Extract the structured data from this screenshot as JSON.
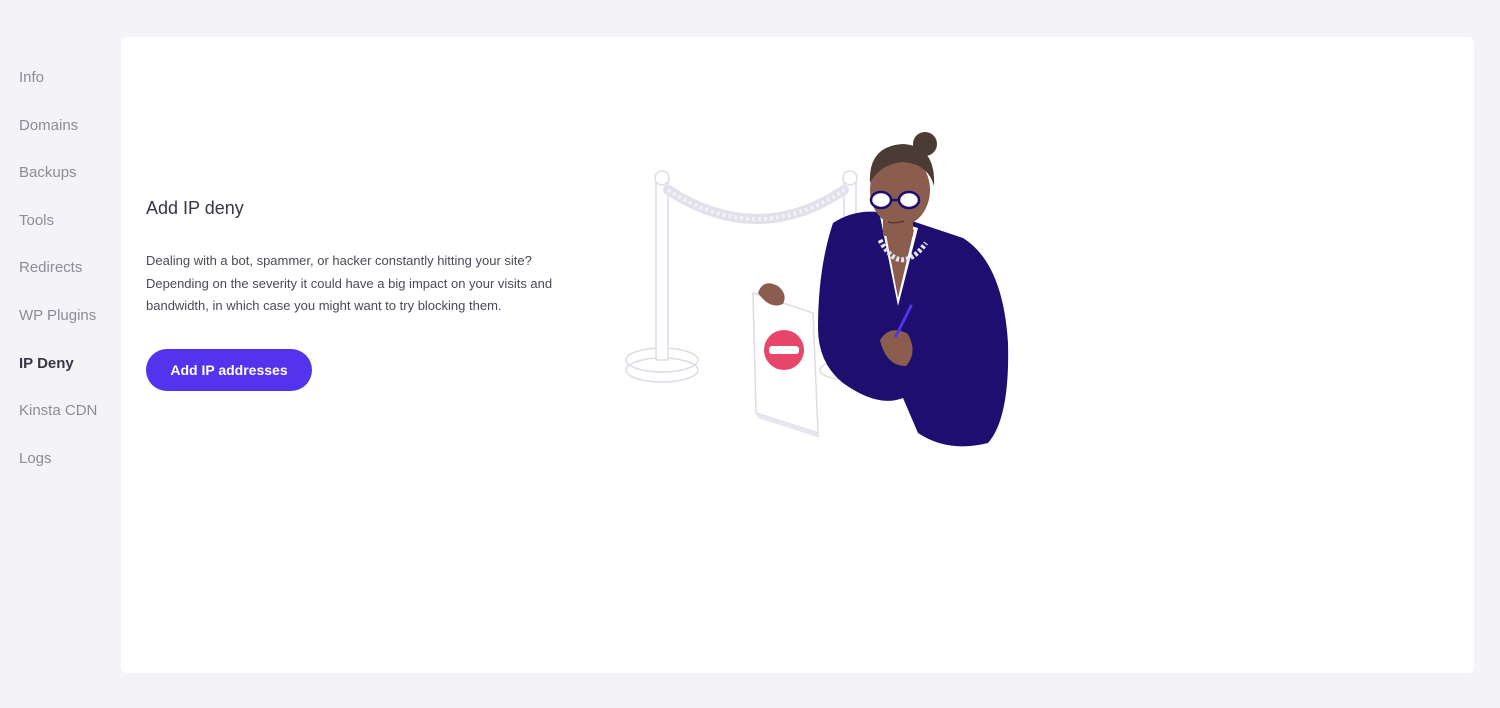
{
  "sidebar": {
    "items": [
      {
        "label": "Info"
      },
      {
        "label": "Domains"
      },
      {
        "label": "Backups"
      },
      {
        "label": "Tools"
      },
      {
        "label": "Redirects"
      },
      {
        "label": "WP Plugins"
      },
      {
        "label": "IP Deny"
      },
      {
        "label": "Kinsta CDN"
      },
      {
        "label": "Logs"
      }
    ],
    "active_item": "IP Deny"
  },
  "main": {
    "title": "Add IP deny",
    "description": "Dealing with a bot, spammer, or hacker constantly hitting your site? Depending on the severity it could have a big impact on your visits and bandwidth, in which case you might want to try blocking them.",
    "add_button_label": "Add IP addresses",
    "illustration_icon": "bouncer-illustration"
  },
  "colors": {
    "accent": "#5333ed",
    "background": "#f4f3f8",
    "card": "#ffffff",
    "sign_red": "#e8456b",
    "navy": "#1e0e6f"
  }
}
